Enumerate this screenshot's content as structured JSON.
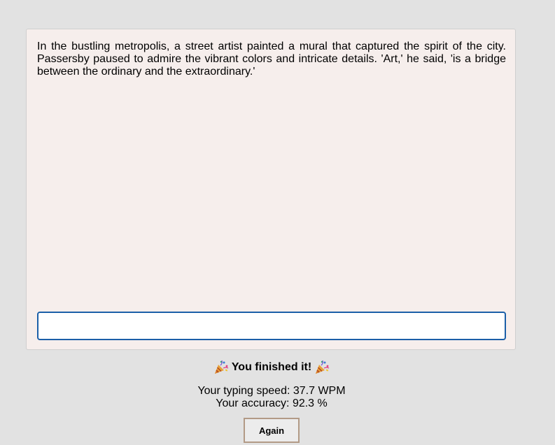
{
  "passage": {
    "text": "In the bustling metropolis, a street artist painted a mural that captured the spirit of the city. Passersby paused to admire the vibrant colors and intricate details. 'Art,' he said, 'is a bridge between the ordinary and the extraordinary.'"
  },
  "input": {
    "value": "",
    "placeholder": ""
  },
  "result": {
    "heading": "You finished it!",
    "icon_left": "party-popper-icon",
    "icon_right": "party-popper-icon",
    "speed_text": "Your typing speed: 37.7 WPM",
    "accuracy_text": "Your accuracy: 92.3 %"
  },
  "actions": {
    "again_label": "Again"
  },
  "colors": {
    "page_background": "#e2e2e2",
    "panel_background": "#f6eeec",
    "input_border": "#1b5fa8",
    "button_border": "#b29a86"
  }
}
